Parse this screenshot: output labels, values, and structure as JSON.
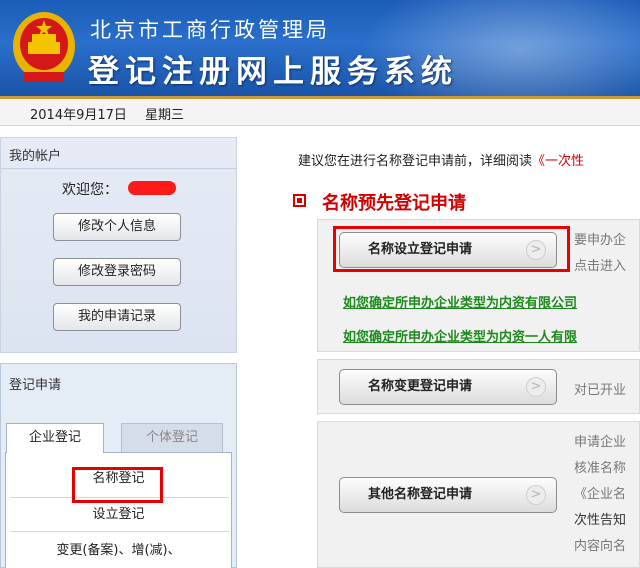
{
  "header": {
    "bureau": "北京市工商行政管理局",
    "system": "登记注册网上服务系统",
    "emblem_icon": "national-emblem-icon"
  },
  "datebar": {
    "date": "2014年9月17日",
    "weekday": "星期三"
  },
  "account": {
    "title": "我的帐户",
    "welcome": "欢迎您：",
    "buttons": [
      "修改个人信息",
      "修改登录密码",
      "我的申请记录"
    ]
  },
  "registration": {
    "title": "登记申请",
    "tabs": [
      "企业登记",
      "个体登记"
    ],
    "items": [
      "名称登记",
      "设立登记",
      "变更(备案)、增(减)、"
    ]
  },
  "main": {
    "note_prefix": "建议您在进行名称登记申请前，详细阅读",
    "note_link": "《一次性",
    "section_title": "名称预先登记申请",
    "panels": [
      {
        "button": "名称设立登记申请",
        "desc": [
          "要申办企",
          "点击进入"
        ],
        "links": [
          "如您确定所申办企业类型为内资有限公司",
          "如您确定所申办企业类型为内资一人有限"
        ]
      },
      {
        "button": "名称变更登记申请",
        "desc": [
          "对已开业"
        ]
      },
      {
        "button": "其他名称登记申请",
        "desc": [
          "申请企业",
          "核准名称",
          "《企业名",
          "次性告知",
          "内容向名"
        ]
      }
    ],
    "chevron_icon": "chevron-right-icon"
  },
  "colors": {
    "banner": "#1b5db8",
    "accent_red": "#d40000",
    "link_green": "#1d8a1d",
    "highlight_box": "#e60000"
  }
}
